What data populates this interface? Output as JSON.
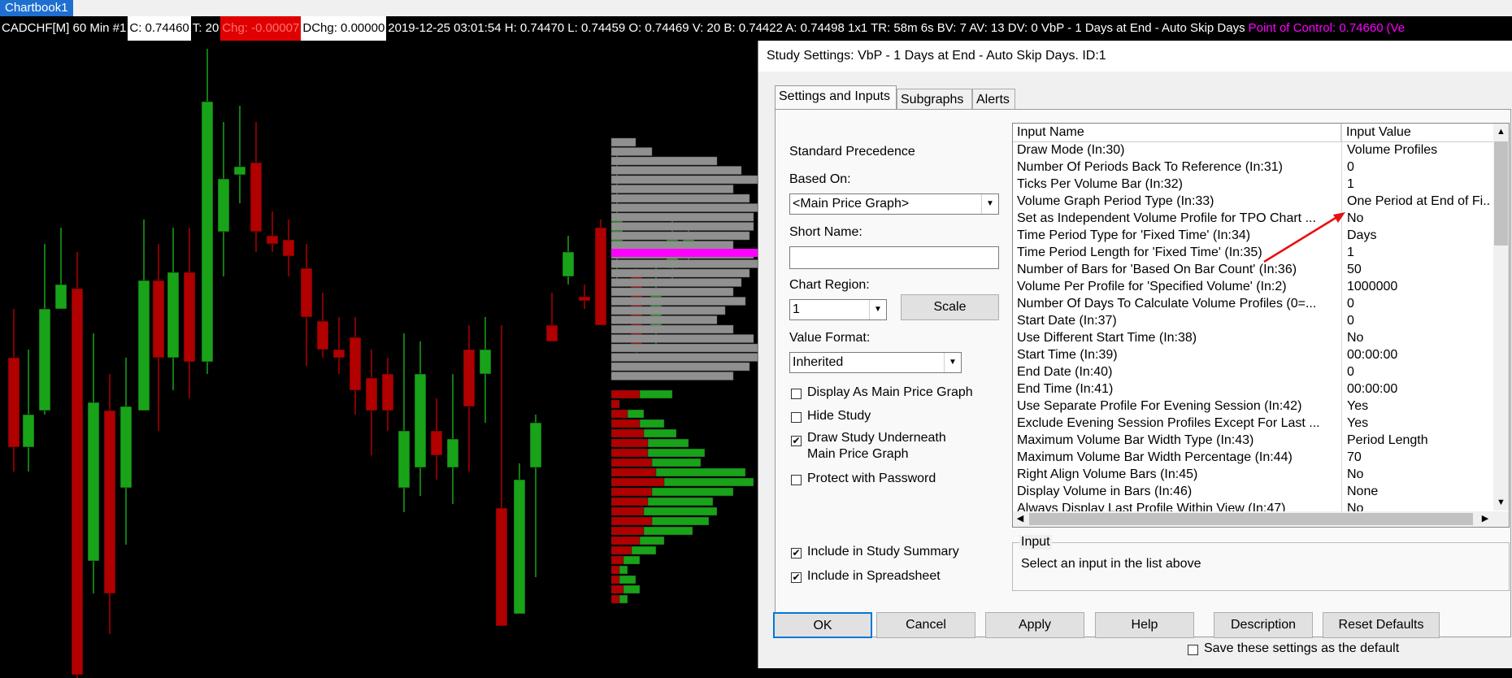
{
  "tab": {
    "label": "Chartbook1"
  },
  "info_bar": {
    "symbol": "CADCHF[M]  60 Min  #1",
    "close": "C: 0.74460",
    "ticks": "T: 20",
    "chg": "Chg: -0.00007",
    "dchg": "DChg: 0.00000",
    "rest": "2019-12-25 03:01:54 H: 0.74470 L: 0.74459 O: 0.74469 V: 20 B: 0.74422 A: 0.74498 1x1 TR: 58m 6s BV: 7 AV: 13 DV: 0 VbP - 1 Days at End - Auto Skip Days",
    "poc": "Point of Control: 0.74660",
    "trail": "(Ve"
  },
  "colors": {
    "up": "#19a319",
    "down": "#b00000",
    "poc": "#ff00ff",
    "profile": "#909090"
  },
  "dialog": {
    "title": "Study Settings: VbP - 1 Days at End - Auto Skip Days. ID:1",
    "tabs": [
      "Settings and Inputs",
      "Subgraphs",
      "Alerts"
    ],
    "standard_precedence": "Standard Precedence",
    "based_on_label": "Based On:",
    "based_on_value": "<Main Price Graph>",
    "short_name_label": "Short Name:",
    "short_name_value": "",
    "chart_region_label": "Chart Region:",
    "chart_region_value": "1",
    "scale_button": "Scale",
    "value_format_label": "Value Format:",
    "value_format_value": "Inherited",
    "checkboxes": [
      {
        "label": "Display As Main Price Graph",
        "checked": false
      },
      {
        "label": "Hide Study",
        "checked": false
      },
      {
        "label": "Draw Study Underneath",
        "label2": "Main Price Graph",
        "checked": true
      },
      {
        "label": "Protect with Password",
        "checked": false
      }
    ],
    "summary_checkboxes": [
      {
        "label": "Include in Study Summary",
        "checked": true
      },
      {
        "label": "Include in Spreadsheet",
        "checked": true
      }
    ],
    "grid": {
      "col_name": "Input Name",
      "col_value": "Input Value",
      "rows": [
        {
          "name": "Draw Mode   (In:30)",
          "value": "Volume Profiles"
        },
        {
          "name": "Number Of Periods Back To Reference   (In:31)",
          "value": "0"
        },
        {
          "name": "Ticks Per Volume Bar   (In:32)",
          "value": "1"
        },
        {
          "name": "Volume Graph Period Type   (In:33)",
          "value": "One Period at End of Fi..."
        },
        {
          "name": "Set as Independent Volume Profile for TPO Chart ...",
          "value": "No"
        },
        {
          "name": "Time Period Type for 'Fixed Time'   (In:34)",
          "value": "Days"
        },
        {
          "name": "Time Period Length for 'Fixed Time'   (In:35)",
          "value": "1"
        },
        {
          "name": "Number of Bars for 'Based On Bar Count'   (In:36)",
          "value": "50"
        },
        {
          "name": "Volume Per Profile for 'Specified Volume'   (In:2)",
          "value": "1000000"
        },
        {
          "name": "Number Of Days To Calculate Volume Profiles (0=...",
          "value": "0"
        },
        {
          "name": "Start Date   (In:37)",
          "value": "0"
        },
        {
          "name": "Use Different Start Time   (In:38)",
          "value": "No"
        },
        {
          "name": "Start Time   (In:39)",
          "value": "00:00:00"
        },
        {
          "name": "End Date   (In:40)",
          "value": "0"
        },
        {
          "name": "End Time   (In:41)",
          "value": "00:00:00"
        },
        {
          "name": "Use Separate Profile For Evening Session   (In:42)",
          "value": "Yes"
        },
        {
          "name": "Exclude Evening Session Profiles Except For Last ...",
          "value": "Yes"
        },
        {
          "name": "Maximum Volume Bar Width Type   (In:43)",
          "value": "Period Length"
        },
        {
          "name": "Maximum Volume Bar Width Percentage   (In:44)",
          "value": "70"
        },
        {
          "name": "Right Align Volume Bars   (In:45)",
          "value": "No"
        },
        {
          "name": "Display Volume in Bars   (In:46)",
          "value": "None"
        },
        {
          "name": "Always Display Last Profile Within View   (In:47)",
          "value": "No"
        }
      ]
    },
    "input_group_label": "Input",
    "input_hint": "Select an input in the list above",
    "buttons": [
      "OK",
      "Cancel",
      "Apply",
      "Help",
      "Description",
      "Reset Defaults"
    ],
    "save_default": "Save these settings as the default"
  }
}
